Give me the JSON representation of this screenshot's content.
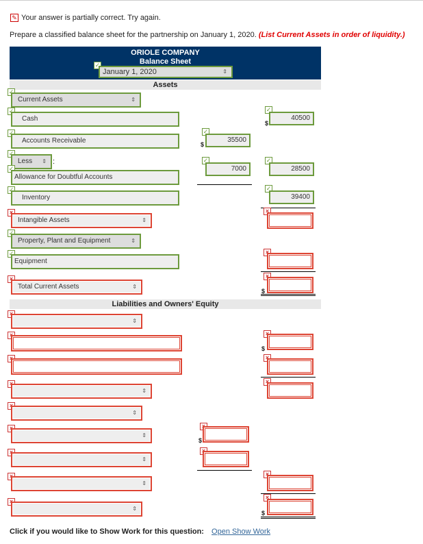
{
  "feedback": {
    "icon": "pencil-icon",
    "text": "Your answer is partially correct.  Try again."
  },
  "prompt": {
    "text": "Prepare a classified balance sheet for the partnership on January 1, 2020.",
    "hint": "(List Current Assets in order of liquidity.)"
  },
  "header": {
    "company": "ORIOLE COMPANY",
    "title": "Balance Sheet",
    "date": "January 1, 2020"
  },
  "sections": {
    "assets": "Assets",
    "liabilities": "Liabilities and Owners' Equity"
  },
  "rows": {
    "current_assets": "Current Assets",
    "cash": "Cash",
    "accounts_receivable": "Accounts Receivable",
    "less": "Less",
    "allowance": "Allowance for Doubtful Accounts",
    "inventory": "Inventory",
    "intangible": "Intangible Assets",
    "ppe": "Property, Plant and Equipment",
    "equipment": "Equipment",
    "total_current": "Total Current Assets"
  },
  "values": {
    "cash": "40500",
    "ar": "35500",
    "allowance": "7000",
    "net_ar": "28500",
    "inventory": "39400"
  },
  "dollar": "$",
  "footer": {
    "text": "Click if you would like to Show Work for this question:",
    "link": "Open Show Work"
  }
}
